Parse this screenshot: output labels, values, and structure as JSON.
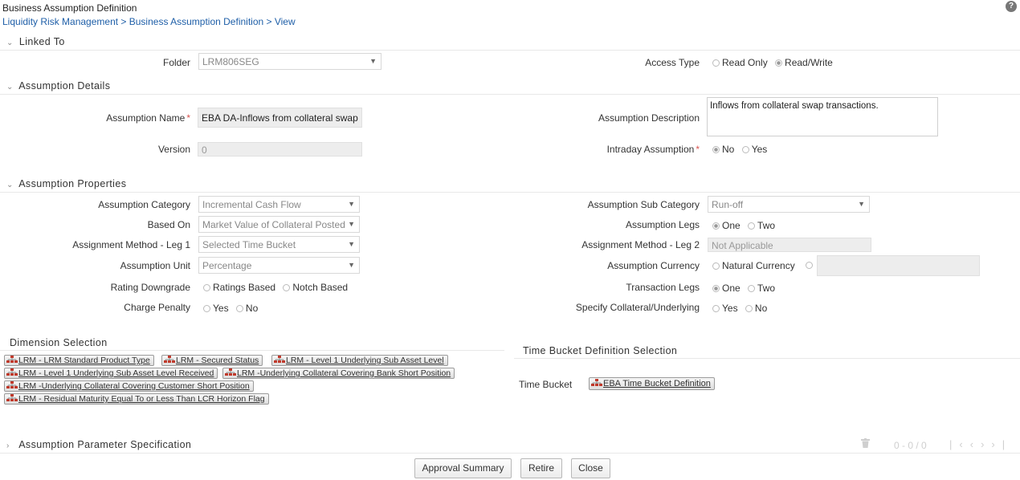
{
  "header": {
    "title": "Business Assumption Definition",
    "breadcrumb": "Liquidity Risk Management > Business Assumption Definition > View",
    "help_symbol": "?"
  },
  "linked_to": {
    "section_title": "Linked To",
    "folder_label": "Folder",
    "folder_value": "LRM806SEG",
    "access_type_label": "Access Type",
    "access_options": [
      "Read Only",
      "Read/Write"
    ],
    "access_selected": "Read/Write"
  },
  "assumption_details": {
    "section_title": "Assumption Details",
    "name_label": "Assumption Name",
    "name_value": "EBA DA-Inflows from collateral swap",
    "description_label": "Assumption Description",
    "description_value": "Inflows from collateral swap transactions.",
    "version_label": "Version",
    "version_value": "0",
    "intraday_label": "Intraday Assumption",
    "intraday_options": [
      "No",
      "Yes"
    ],
    "intraday_selected": "No",
    "required_marker": "*"
  },
  "assumption_properties": {
    "section_title": "Assumption Properties",
    "category_label": "Assumption Category",
    "category_value": "Incremental Cash Flow",
    "sub_category_label": "Assumption Sub Category",
    "sub_category_value": "Run-off",
    "based_on_label": "Based On",
    "based_on_value": "Market Value of Collateral Posted",
    "legs_label": "Assumption Legs",
    "legs_options": [
      "One",
      "Two"
    ],
    "legs_selected": "One",
    "method_leg1_label": "Assignment Method - Leg 1",
    "method_leg1_value": "Selected Time Bucket",
    "method_leg2_label": "Assignment Method - Leg 2",
    "method_leg2_value": "Not Applicable",
    "unit_label": "Assumption Unit",
    "unit_value": "Percentage",
    "currency_label": "Assumption Currency",
    "currency_options": [
      "Natural Currency"
    ],
    "rating_label": "Rating Downgrade",
    "rating_options": [
      "Ratings Based",
      "Notch Based"
    ],
    "transaction_legs_label": "Transaction Legs",
    "transaction_legs_options": [
      "One",
      "Two"
    ],
    "transaction_legs_selected": "One",
    "penalty_label": "Charge Penalty",
    "penalty_options": [
      "Yes",
      "No"
    ],
    "collateral_label": "Specify Collateral/Underlying",
    "collateral_options": [
      "Yes",
      "No"
    ]
  },
  "dimension_selection": {
    "title": "Dimension Selection",
    "chips": [
      "LRM - LRM Standard Product Type",
      "LRM - Secured Status",
      "LRM - Level 1 Underlying Sub Asset Level",
      "LRM - Level 1 Underlying Sub Asset Level Received",
      "LRM -Underlying Collateral Covering Bank Short Position",
      "LRM -Underlying Collateral Covering Customer Short Position",
      "LRM - Residual Maturity Equal To or Less Than LCR Horizon Flag"
    ]
  },
  "time_bucket_selection": {
    "title": "Time Bucket Definition Selection",
    "label": "Time Bucket",
    "chip": "EBA Time Bucket Definition"
  },
  "parameter_spec": {
    "section_title": "Assumption Parameter Specification",
    "pager_text": "0 - 0 / 0"
  },
  "footer": {
    "approval_summary": "Approval Summary",
    "retire": "Retire",
    "close": "Close"
  },
  "icons": {
    "chevron_expanded": "chevron-down-icon",
    "chevron_collapsed": "chevron-right-icon",
    "dimension": "hierarchy-icon",
    "delete": "trash-icon"
  }
}
